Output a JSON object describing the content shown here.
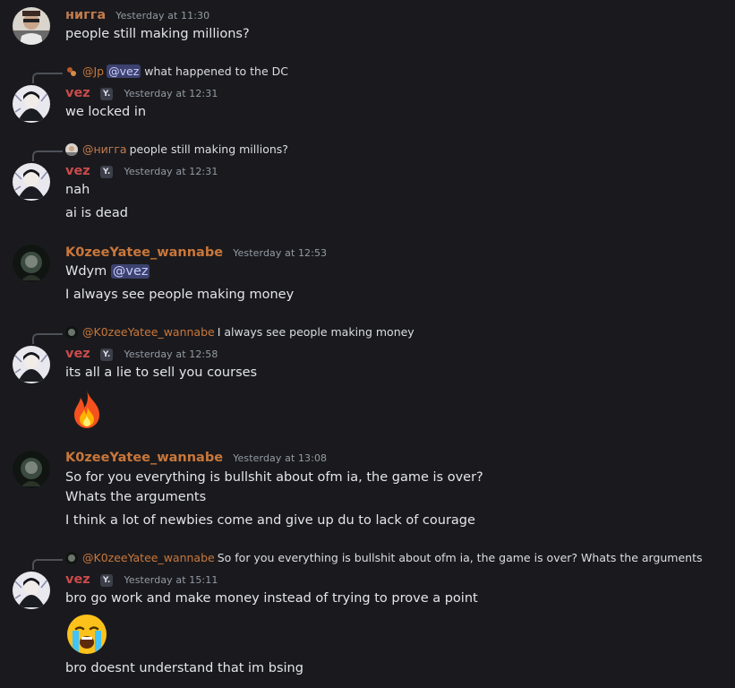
{
  "messages": [
    {
      "author": "нигга",
      "timestamp": "Yesterday at 11:30",
      "lines": [
        "people still making millions?"
      ]
    },
    {
      "reply": {
        "name": "@Jp",
        "mention": "@vez",
        "text": "what happened to the DC"
      },
      "author": "vez",
      "tag": "Y.",
      "timestamp": "Yesterday at 12:31",
      "lines": [
        "we locked in"
      ]
    },
    {
      "reply": {
        "name": "@нигга",
        "text": "people still making millions?"
      },
      "author": "vez",
      "tag": "Y.",
      "timestamp": "Yesterday at 12:31",
      "lines": [
        "nah",
        "ai is dead"
      ]
    },
    {
      "author": "K0zeeYatee_wannabe",
      "timestamp": "Yesterday at 12:53",
      "lines_pre": "Wdym",
      "mention": "@vez",
      "lines": [
        "I always see people making money"
      ]
    },
    {
      "reply": {
        "name": "@K0zeeYatee_wannabe",
        "text": "I always see people making money"
      },
      "author": "vez",
      "tag": "Y.",
      "timestamp": "Yesterday at 12:58",
      "lines": [
        "its all a lie to sell you courses"
      ],
      "emoji": "fire-emoji"
    },
    {
      "author": "K0zeeYatee_wannabe",
      "timestamp": "Yesterday at 13:08",
      "lines": [
        "So for you everything is bullshit about ofm ia, the game is over?",
        "Whats the arguments",
        "I think a lot of newbies come and give up du to lack of courage"
      ]
    },
    {
      "reply": {
        "name": "@K0zeeYatee_wannabe",
        "text": "So for you everything is bullshit about ofm ia, the game is over?  Whats the arguments"
      },
      "author": "vez",
      "tag": "Y.",
      "timestamp": "Yesterday at 15:11",
      "lines": [
        "bro go work and make money instead of trying to prove a point",
        "bro doesnt understand that im bsing"
      ],
      "emoji": "loudly-crying-emoji"
    }
  ],
  "colors": {
    "background": "#1a1a1e",
    "vez": "#c94b4b",
    "nigga": "#c27c4e",
    "kozee": "#c9773a",
    "mention_bg": "#3c4270"
  }
}
